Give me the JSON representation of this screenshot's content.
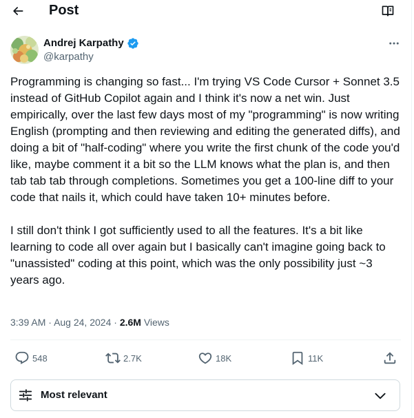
{
  "header": {
    "title": "Post",
    "back_icon": "arrow-left-icon",
    "reader_icon": "reader-mode-icon"
  },
  "author": {
    "name": "Andrej Karpathy",
    "handle": "@karpathy",
    "verified_color": "#1d9bf0"
  },
  "tweet": {
    "paragraphs": [
      "Programming is changing so fast... I'm trying VS Code Cursor + Sonnet 3.5 instead of GitHub Copilot again and I think it's now a net win. Just empirically, over the last few days most of my \"programming\" is now writing English (prompting and then reviewing and editing the generated diffs), and doing a bit of \"half-coding\" where you write the first chunk of the code you'd like, maybe comment it a bit so the LLM knows what the plan is, and then tab tab tab through completions. Sometimes you get a 100-line diff to your code that nails it, which could have taken 10+ minutes before.",
      "I still don't think I got sufficiently used to all the features. It's a bit like learning to code all over again but I basically can't imagine going back to \"unassisted\" coding at this point, which was the only possibility just ~3 years ago."
    ]
  },
  "meta": {
    "time": "3:39 AM",
    "separator": "·",
    "date": "Aug 24, 2024",
    "views_count": "2.6M",
    "views_label": "Views"
  },
  "actions": {
    "replies": "548",
    "reposts": "2.7K",
    "likes": "18K",
    "bookmarks": "11K"
  },
  "sort": {
    "label": "Most relevant"
  },
  "colors": {
    "text": "#0f1419",
    "secondary": "#536471",
    "border": "#cfd9de",
    "divider": "#eff3f4",
    "accent": "#1d9bf0"
  }
}
